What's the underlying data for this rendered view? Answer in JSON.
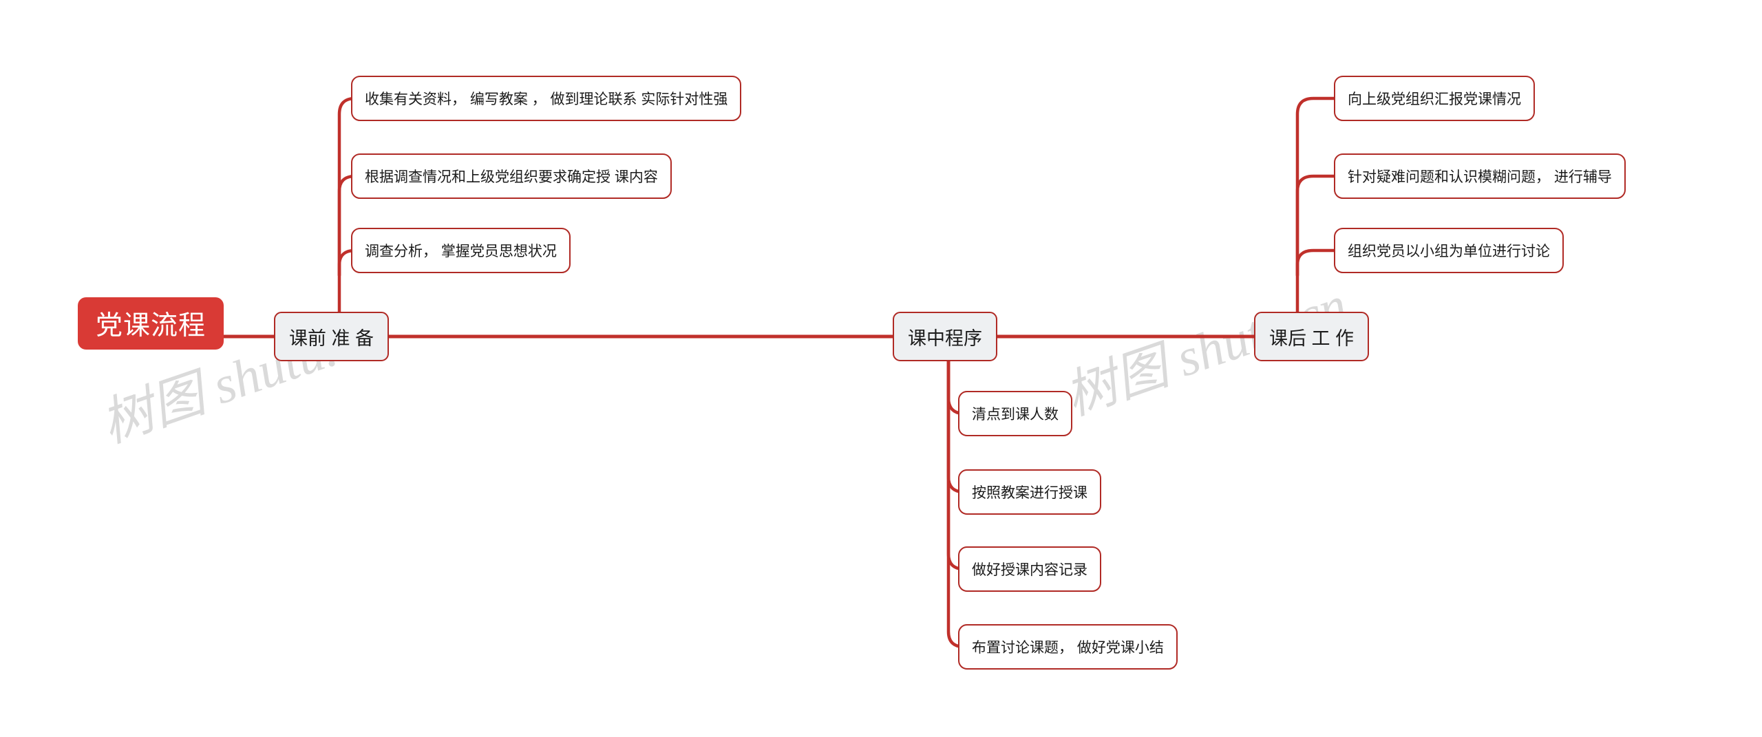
{
  "diagram": {
    "title": "党课流程",
    "watermark_text": "树图 shutu.cn",
    "colors": {
      "root_fill": "#d93a35",
      "root_text": "#ffffff",
      "branch_fill": "#eef0f2",
      "branch_border": "#b02a25",
      "leaf_fill": "#ffffff",
      "leaf_border": "#b02a25",
      "edge": "#c0302b",
      "watermark": "#d4d4d4",
      "background": "#ffffff"
    }
  },
  "root": {
    "label": "党课流程"
  },
  "branches": [
    {
      "id": "pre-class",
      "label": "课前 准 备",
      "children": [
        {
          "label": "收集有关资料， 编写教案 ， 做到理论联系 实际针对性强"
        },
        {
          "label": "根据调查情况和上级党组织要求确定授 课内容"
        },
        {
          "label": "调查分析， 掌握党员思想状况"
        }
      ]
    },
    {
      "id": "in-class",
      "label": "课中程序",
      "children": [
        {
          "label": "清点到课人数"
        },
        {
          "label": "按照教案进行授课"
        },
        {
          "label": "做好授课内容记录"
        },
        {
          "label": "布置讨论课题， 做好党课小结"
        }
      ]
    },
    {
      "id": "post-class",
      "label": "课后 工 作",
      "children": [
        {
          "label": "向上级党组织汇报党课情况"
        },
        {
          "label": "针对疑难问题和认识模糊问题， 进行辅导"
        },
        {
          "label": "组织党员以小组为单位进行讨论"
        }
      ]
    }
  ]
}
